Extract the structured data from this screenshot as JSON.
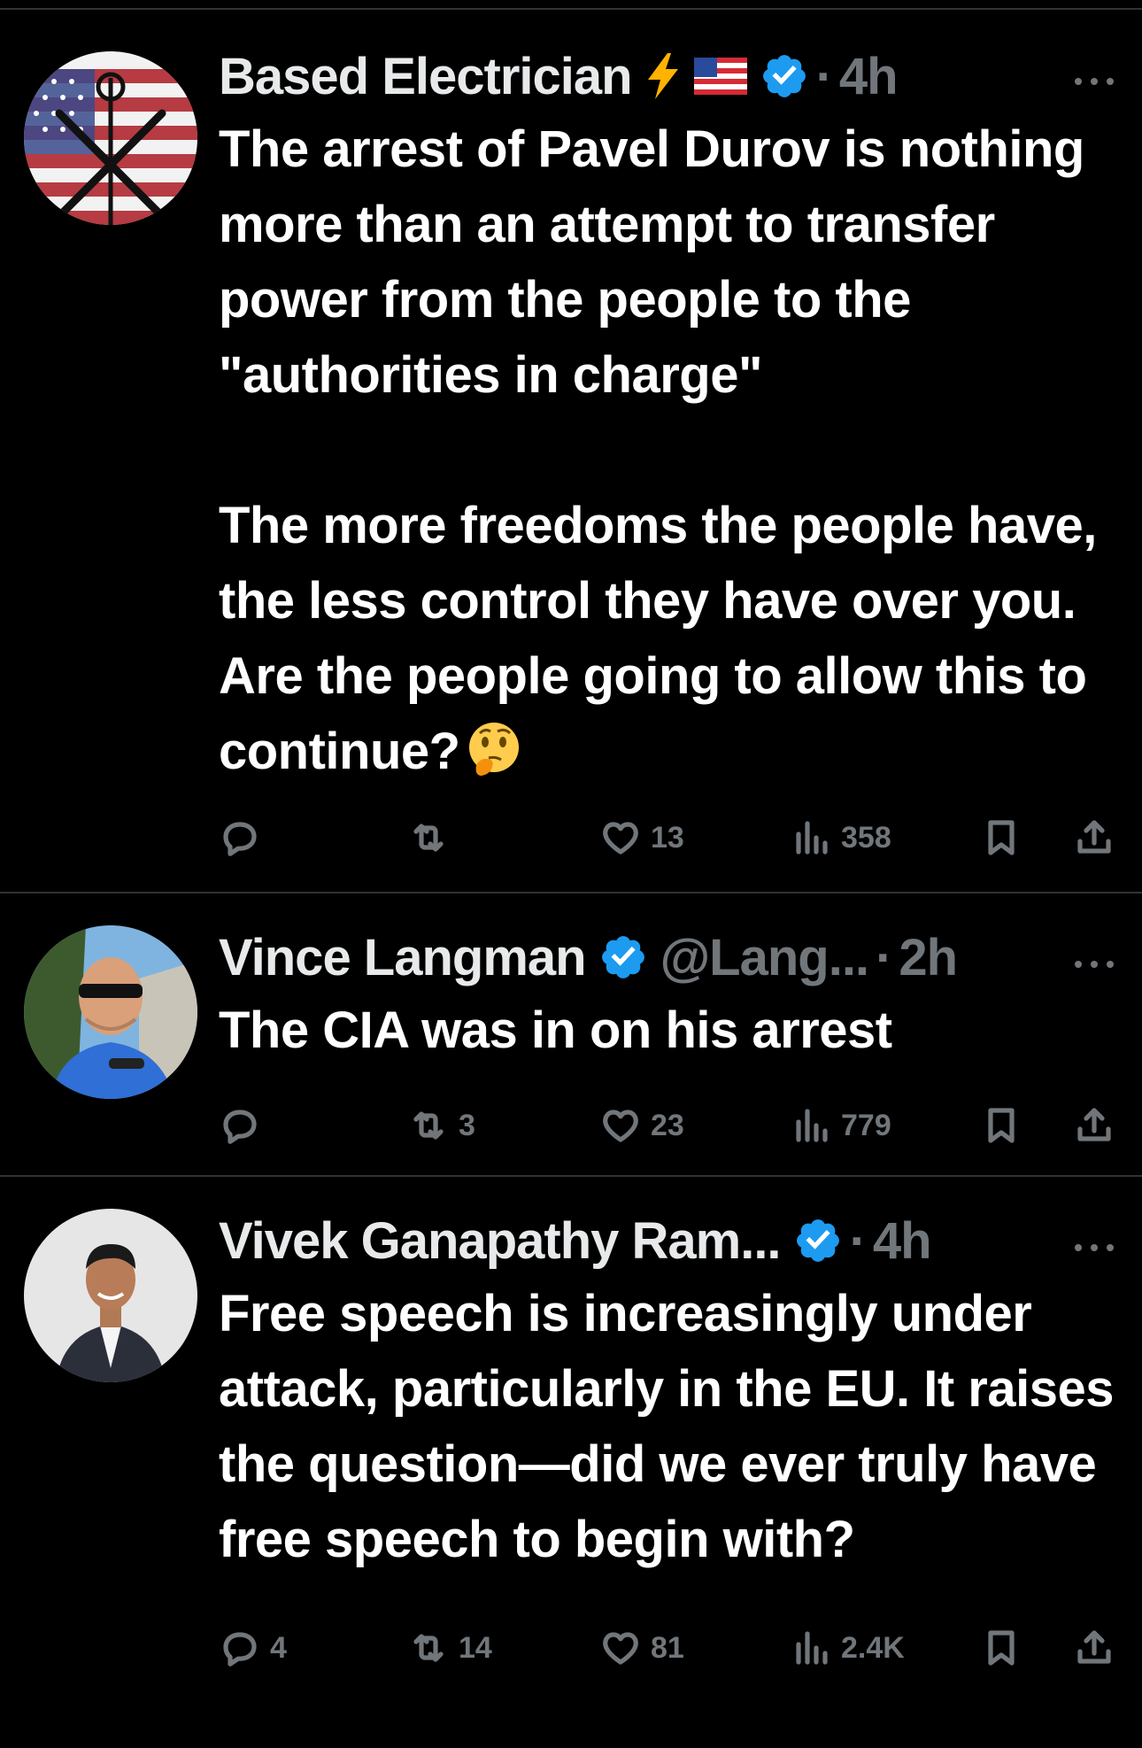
{
  "tweets": [
    {
      "author": "Based Electrician",
      "emojis": [
        "lightning-emoji",
        "us-flag-emoji"
      ],
      "verified": true,
      "handle": "",
      "separator": "·",
      "time": "4h",
      "text_1": "The arrest of Pavel Durov is nothing more than an attempt to transfer power from the people to the \"authorities in charge\"",
      "text_2": "The more freedoms the people have, the less control they have over you. Are the people going to allow this to continue?",
      "text_emoji": "thinking-face-emoji",
      "replies": "",
      "retweets": "",
      "likes": "13",
      "views": "358"
    },
    {
      "author": "Vince Langman",
      "verified": true,
      "handle": "@Lang...",
      "separator": "·",
      "time": "2h",
      "text": "The CIA was in on his arrest",
      "replies": "",
      "retweets": "3",
      "likes": "23",
      "views": "779"
    },
    {
      "author": "Vivek Ganapathy Ram...",
      "verified": true,
      "handle": "",
      "separator": "·",
      "time": "4h",
      "text": "Free speech is increasingly under attack, particularly in the EU. It raises the question—did we ever truly have free speech to begin with?",
      "replies": "4",
      "retweets": "14",
      "likes": "81",
      "views": "2.4K"
    }
  ],
  "colors": {
    "background": "#000000",
    "text_primary": "#ffffff",
    "text_secondary": "#71767b",
    "divider": "#2f3336",
    "verified_blue": "#1d9bf0"
  }
}
